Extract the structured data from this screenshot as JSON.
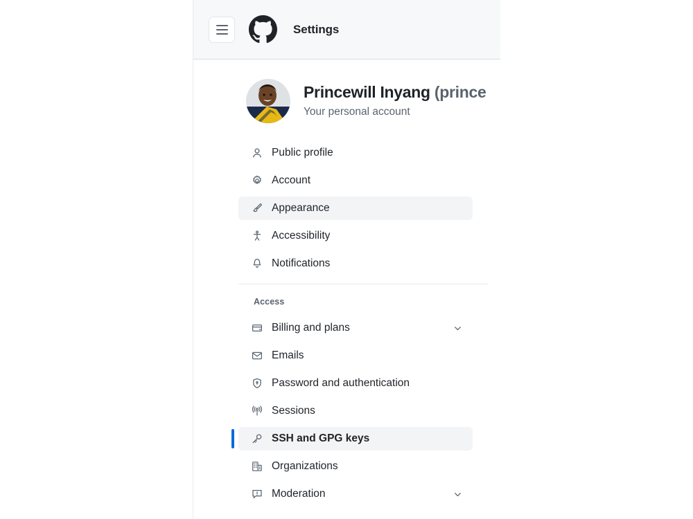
{
  "header": {
    "menu_button": "menu-toggle",
    "logo": "github-logo",
    "title": "Settings"
  },
  "profile": {
    "avatar_alt": "user-avatar",
    "name": "Princewill Inyang",
    "handle": "(prince",
    "subtitle": "Your personal account"
  },
  "nav": {
    "primary_items": [
      {
        "label": "Public profile",
        "icon": "person-icon",
        "state": "default",
        "chevron": false
      },
      {
        "label": "Account",
        "icon": "gear-icon",
        "state": "default",
        "chevron": false
      },
      {
        "label": "Appearance",
        "icon": "paintbrush-icon",
        "state": "hovered",
        "chevron": false
      },
      {
        "label": "Accessibility",
        "icon": "accessibility-icon",
        "state": "default",
        "chevron": false
      },
      {
        "label": "Notifications",
        "icon": "bell-icon",
        "state": "default",
        "chevron": false
      }
    ],
    "access_group_title": "Access",
    "access_items": [
      {
        "label": "Billing and plans",
        "icon": "credit-card-icon",
        "state": "default",
        "chevron": true
      },
      {
        "label": "Emails",
        "icon": "mail-icon",
        "state": "default",
        "chevron": false
      },
      {
        "label": "Password and authentication",
        "icon": "shield-lock-icon",
        "state": "default",
        "chevron": false
      },
      {
        "label": "Sessions",
        "icon": "broadcast-icon",
        "state": "default",
        "chevron": false
      },
      {
        "label": "SSH and GPG keys",
        "icon": "key-icon",
        "state": "selected",
        "chevron": false
      },
      {
        "label": "Organizations",
        "icon": "organization-icon",
        "state": "default",
        "chevron": false
      },
      {
        "label": "Moderation",
        "icon": "report-icon",
        "state": "default",
        "chevron": true
      }
    ]
  },
  "colors": {
    "accent": "#0969da",
    "header_bg": "#f6f8fa",
    "row_active_bg": "#f3f4f6",
    "text_primary": "#1f2328",
    "text_muted": "#59636e"
  }
}
